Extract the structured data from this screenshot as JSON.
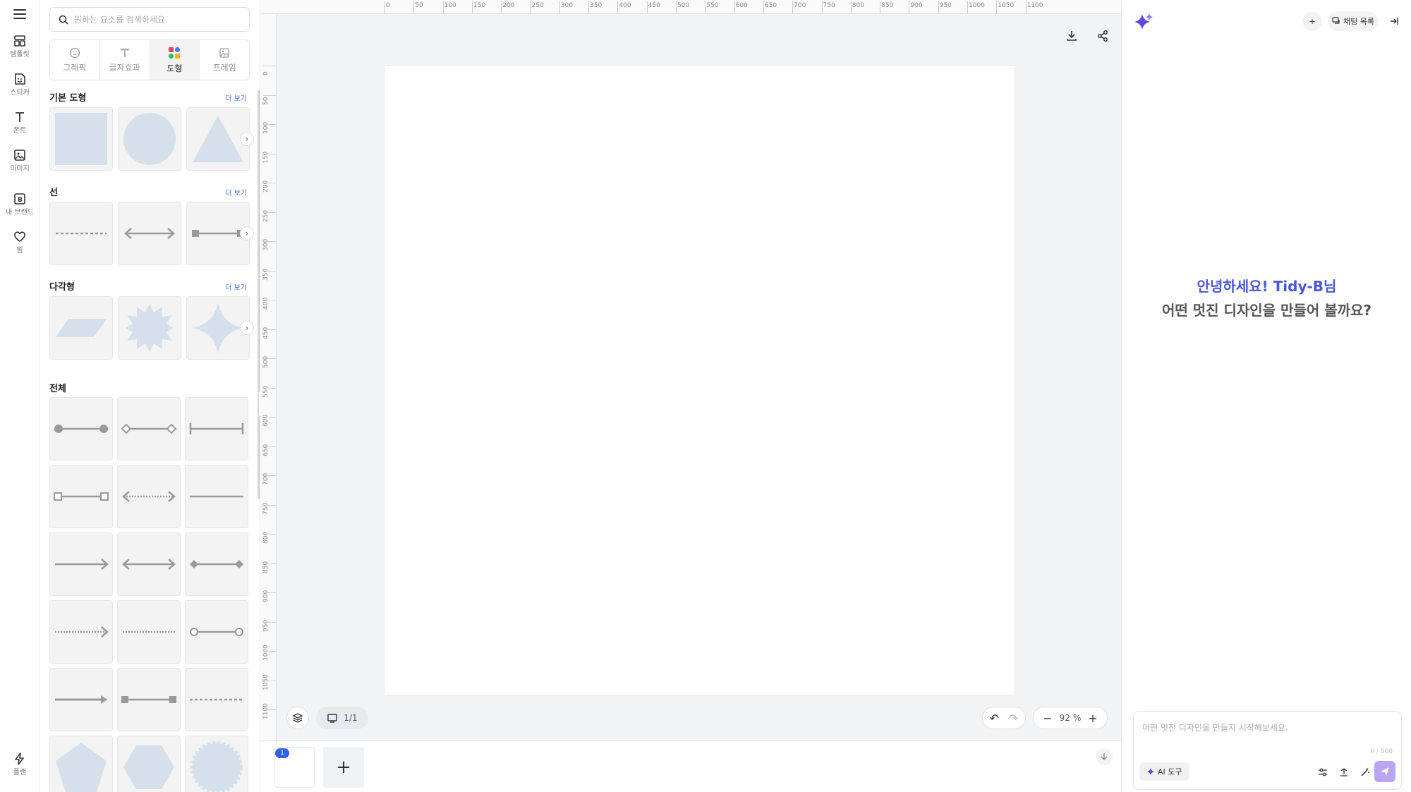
{
  "rail": {
    "items": [
      {
        "label": "템플릿",
        "icon": "template-icon"
      },
      {
        "label": "스티커",
        "icon": "sticker-icon"
      },
      {
        "label": "폰트",
        "icon": "font-icon"
      },
      {
        "label": "이미지",
        "icon": "image-icon"
      },
      {
        "label": "내 브랜드",
        "icon": "brand-icon"
      },
      {
        "label": "찜",
        "icon": "heart-icon"
      }
    ],
    "bottom": {
      "label": "플랜",
      "icon": "bolt-icon"
    }
  },
  "panel": {
    "search_placeholder": "원하는 요소를 검색하세요.",
    "tabs": [
      {
        "label": "그래픽",
        "icon": "smile-icon",
        "active": false
      },
      {
        "label": "글자효과",
        "icon": "text-effect-icon",
        "active": false
      },
      {
        "label": "도형",
        "icon": "shapes-icon",
        "active": true
      },
      {
        "label": "프레임",
        "icon": "frame-icon",
        "active": false
      }
    ],
    "sections": {
      "basic": {
        "title": "기본 도형",
        "more": "더 보기"
      },
      "lines": {
        "title": "선",
        "more": "더 보기"
      },
      "polygons": {
        "title": "다각형",
        "more": "더 보기"
      },
      "all": {
        "title": "전체"
      }
    }
  },
  "ruler": {
    "top": [
      "0",
      "50",
      "100",
      "150",
      "200",
      "250",
      "300",
      "350",
      "400",
      "450",
      "500",
      "550",
      "600",
      "650",
      "700",
      "750",
      "800",
      "850",
      "900",
      "950",
      "1000",
      "1050",
      "1100"
    ],
    "left": [
      "0",
      "50",
      "100",
      "150",
      "200",
      "250",
      "300",
      "350",
      "400",
      "450",
      "500",
      "550",
      "600",
      "650",
      "700",
      "750",
      "800",
      "850",
      "900",
      "950",
      "1000",
      "1050",
      "1100"
    ]
  },
  "canvas": {
    "page_indicator": "1/1",
    "zoom_value": "92",
    "zoom_unit": "%"
  },
  "pages": {
    "badge": "1",
    "add": "+"
  },
  "ai": {
    "new_chat": "+",
    "chat_list": "채팅 목록",
    "greeting_line1": "안녕하세요! Tidy-B님",
    "greeting_line2": "어떤 멋진 디자인을 만들어 볼까요?",
    "input_placeholder": "어떤 멋진 디자인을 만들지 시작해보세요.",
    "char_count": "0 / 500",
    "ai_tool_label": "AI 도구"
  },
  "colors": {
    "accent": "#4a57d6",
    "shape_fill": "#d6e0ea",
    "line_gray": "#9a9a9a",
    "send_bg": "#b9a6f2"
  }
}
